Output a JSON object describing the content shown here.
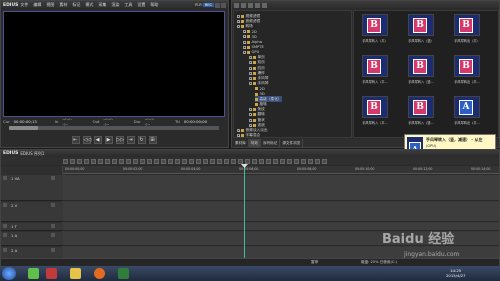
{
  "app": {
    "name": "EDIUS"
  },
  "player": {
    "menu": [
      "文件",
      "编辑",
      "视图",
      "素材",
      "标记",
      "模式",
      "采集",
      "渲染",
      "工具",
      "设置",
      "帮助"
    ],
    "plr_label": "PLR",
    "rec_label": "REC",
    "timecode": {
      "cur_label": "Cur",
      "cur_value": "00:00:00;13",
      "in_label": "In",
      "in_value": "--:--:--;--",
      "out_label": "Out",
      "out_value": "--:--:--;--",
      "dur_label": "Dur",
      "dur_value": "--:--:--;--",
      "ttl_label": "Ttl",
      "ttl_value": "00:00:00;00"
    },
    "scrub_progress": 0.14,
    "controls": [
      "⇤",
      "◁◁",
      "◀",
      "▶",
      "▷▷",
      "⇥",
      "↻",
      "⊞"
    ]
  },
  "bin": {
    "tree": [
      {
        "label": "视频滤镜",
        "depth": 0,
        "expand": "-"
      },
      {
        "label": "音频滤镜",
        "depth": 0,
        "expand": "+"
      },
      {
        "label": "转场",
        "depth": 0,
        "expand": "-"
      },
      {
        "label": "2D",
        "depth": 1,
        "expand": "+"
      },
      {
        "label": "3D",
        "depth": 1,
        "expand": "+"
      },
      {
        "label": "Alpha",
        "depth": 1,
        "expand": "+"
      },
      {
        "label": "SMPTE",
        "depth": 1,
        "expand": "+"
      },
      {
        "label": "GPU",
        "depth": 1,
        "expand": "-"
      },
      {
        "label": "单页",
        "depth": 2,
        "expand": "+"
      },
      {
        "label": "双页",
        "depth": 2,
        "expand": "+"
      },
      {
        "label": "四页",
        "depth": 2,
        "expand": "+"
      },
      {
        "label": "爆炸",
        "depth": 2,
        "expand": "+"
      },
      {
        "label": "手风琴",
        "depth": 2,
        "expand": "+"
      },
      {
        "label": "手风琴",
        "depth": 2,
        "expand": "-"
      },
      {
        "label": "2D",
        "depth": 3,
        "expand": ""
      },
      {
        "label": "3D",
        "depth": 3,
        "expand": ""
      },
      {
        "label": "高级（柔化）",
        "depth": 3,
        "expand": ""
      },
      {
        "label": "旋转",
        "depth": 3,
        "expand": ""
      },
      {
        "label": "条纹",
        "depth": 2,
        "expand": "+"
      },
      {
        "label": "翻转",
        "depth": 2,
        "expand": "+"
      },
      {
        "label": "管状",
        "depth": 2,
        "expand": "+"
      },
      {
        "label": "波浪",
        "depth": 2,
        "expand": "+"
      },
      {
        "label": "音频淡入淡出",
        "depth": 0,
        "expand": "+"
      },
      {
        "label": "字幕混合",
        "depth": 0,
        "expand": "+"
      }
    ],
    "thumbnails": [
      {
        "letter": "B",
        "label": "手风琴转入（平）",
        "color": "pink"
      },
      {
        "letter": "B",
        "label": "手风琴转入（竖）",
        "color": "pink"
      },
      {
        "letter": "B",
        "label": "手风琴转出（平）",
        "color": "pink"
      },
      {
        "letter": "B",
        "label": "手风琴转入（平…",
        "color": "pink"
      },
      {
        "letter": "B",
        "label": "手风琴转入（竖…",
        "color": "pink"
      },
      {
        "letter": "B",
        "label": "手风琴转出（平…",
        "color": "pink"
      },
      {
        "letter": "B",
        "label": "手风琴转入（平…",
        "color": "pink"
      },
      {
        "letter": "B",
        "label": "手风琴转入（竖…",
        "color": "pink"
      },
      {
        "letter": "A",
        "label": "手风琴转出（平…",
        "color": "blue"
      }
    ],
    "tabs": [
      "素材库",
      "特效",
      "序列标记",
      "源文件浏览"
    ]
  },
  "tooltip": {
    "title": "手风琴转入（竖，减速） - 从左",
    "line1": "(GPU)",
    "line2": "3D过渡效果 · 基于GPU的特殊",
    "line3": "支持GPU加速渲染运算。"
  },
  "timeline": {
    "sequence_label": "EDIUS 序列1",
    "ruler_ticks": [
      "00:00:00;00",
      "00:00:02;00",
      "00:00:04;00",
      "00:00:06;00",
      "00:00:08;00",
      "00:00:10;00",
      "00:00:12;00",
      "00:00:14;00"
    ],
    "tracks": [
      {
        "name": "1 VA",
        "kind": "va"
      },
      {
        "name": "2 V",
        "kind": "v"
      },
      {
        "name": "1 T",
        "kind": "t"
      },
      {
        "name": "1 A",
        "kind": "a"
      },
      {
        "name": "2 A",
        "kind": "a"
      }
    ],
    "status": "暂停",
    "free_space": "磁盘: 25% 已使用(C:)"
  },
  "taskbar": {
    "time": "14:25",
    "date": "2015/4/27"
  },
  "watermark": {
    "text": "Baidu 经验",
    "url": "jingyan.baidu.com"
  },
  "colors": {
    "accent": "#2d5fa8",
    "playhead": "#3bbf9e",
    "thumb_bg": "#1b2c72",
    "card_pink": "#d33a6b",
    "card_blue": "#2e5fc6"
  }
}
